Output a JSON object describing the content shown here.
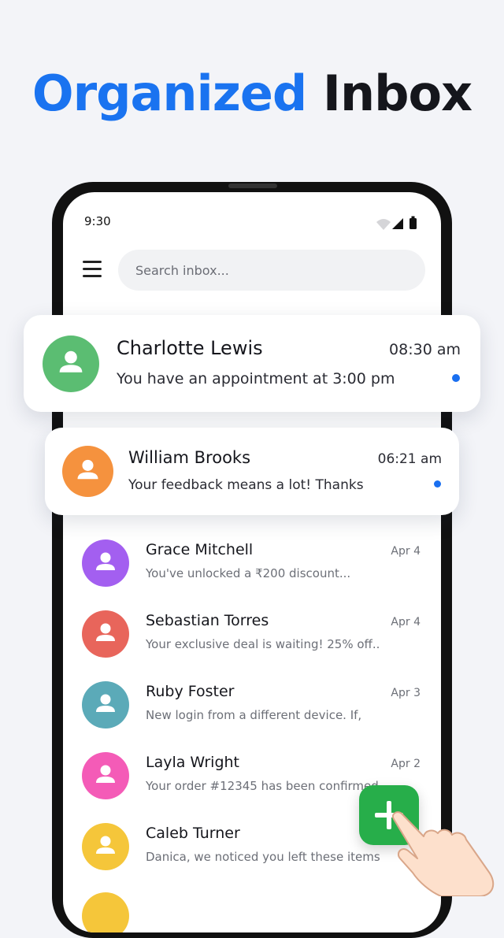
{
  "headline": {
    "part1": "Organized",
    "part2": "Inbox"
  },
  "status_bar": {
    "time": "9:30",
    "icons": [
      "wifi-icon",
      "signal-icon",
      "battery-icon"
    ]
  },
  "search": {
    "placeholder": "Search inbox..."
  },
  "featured": [
    {
      "name": "Charlotte Lewis",
      "time": "08:30 am",
      "preview": "You have an appointment at 3:00 pm",
      "avatar_color": "#5bbd72",
      "unread": true
    },
    {
      "name": "William Brooks",
      "time": "06:21 am",
      "preview": "Your feedback means a lot! Thanks",
      "avatar_color": "#f5923e",
      "unread": true
    }
  ],
  "messages": [
    {
      "name": "Grace Mitchell",
      "date": "Apr 4",
      "preview": "You've unlocked a ₹200 discount...",
      "avatar_color": "#a35ff0"
    },
    {
      "name": "Sebastian Torres",
      "date": "Apr 4",
      "preview": "Your exclusive deal is waiting! 25% off..",
      "avatar_color": "#e8655b"
    },
    {
      "name": "Ruby Foster",
      "date": "Apr 3",
      "preview": "New login from a different device. If,",
      "avatar_color": "#5baab8"
    },
    {
      "name": "Layla Wright",
      "date": "Apr 2",
      "preview": "Your order #12345 has been confirmed",
      "avatar_color": "#f45bb7"
    },
    {
      "name": "Caleb Turner",
      "date": "",
      "preview": "Danica, we noticed you left these items",
      "avatar_color": "#f5c63a"
    }
  ],
  "colors": {
    "accent_blue": "#1a73f0",
    "fab_green": "#27ae4a",
    "unread_dot": "#1a6ff0"
  },
  "fab": {
    "icon": "plus-icon"
  }
}
